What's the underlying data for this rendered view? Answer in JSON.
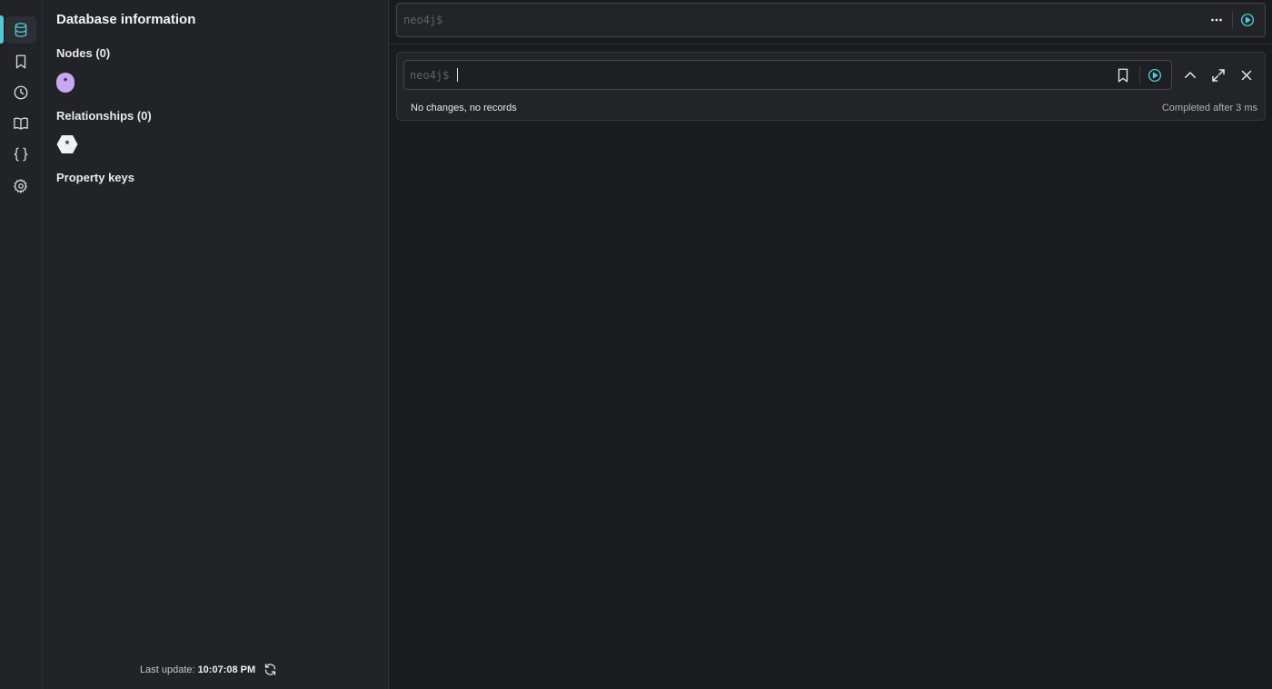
{
  "sidebar": {
    "items": [
      {
        "id": "database",
        "icon": "database-icon",
        "active": true
      },
      {
        "id": "favorites",
        "icon": "bookmark-icon",
        "active": false
      },
      {
        "id": "history",
        "icon": "clock-icon",
        "active": false
      },
      {
        "id": "guides",
        "icon": "book-icon",
        "active": false
      },
      {
        "id": "cypher",
        "icon": "braces-icon",
        "active": false
      },
      {
        "id": "settings",
        "icon": "gear-icon",
        "active": false
      }
    ]
  },
  "db_panel": {
    "title": "Database information",
    "nodes_label": "Nodes (0)",
    "node_pill": "*",
    "relationships_label": "Relationships (0)",
    "relationship_pill": "*",
    "property_keys_label": "Property keys",
    "last_update_label": "Last update:",
    "last_update_time": "10:07:08 PM"
  },
  "editor": {
    "prompt": "neo4j$"
  },
  "frame": {
    "prompt": "neo4j$",
    "status": "No changes, no records",
    "timing": "Completed after 3 ms"
  },
  "colors": {
    "accent": "#55c7d8",
    "node_color": "#c8a8f2",
    "relationship_color": "#f0f1f2",
    "background": "#1a1b1d",
    "panel": "#222326"
  }
}
